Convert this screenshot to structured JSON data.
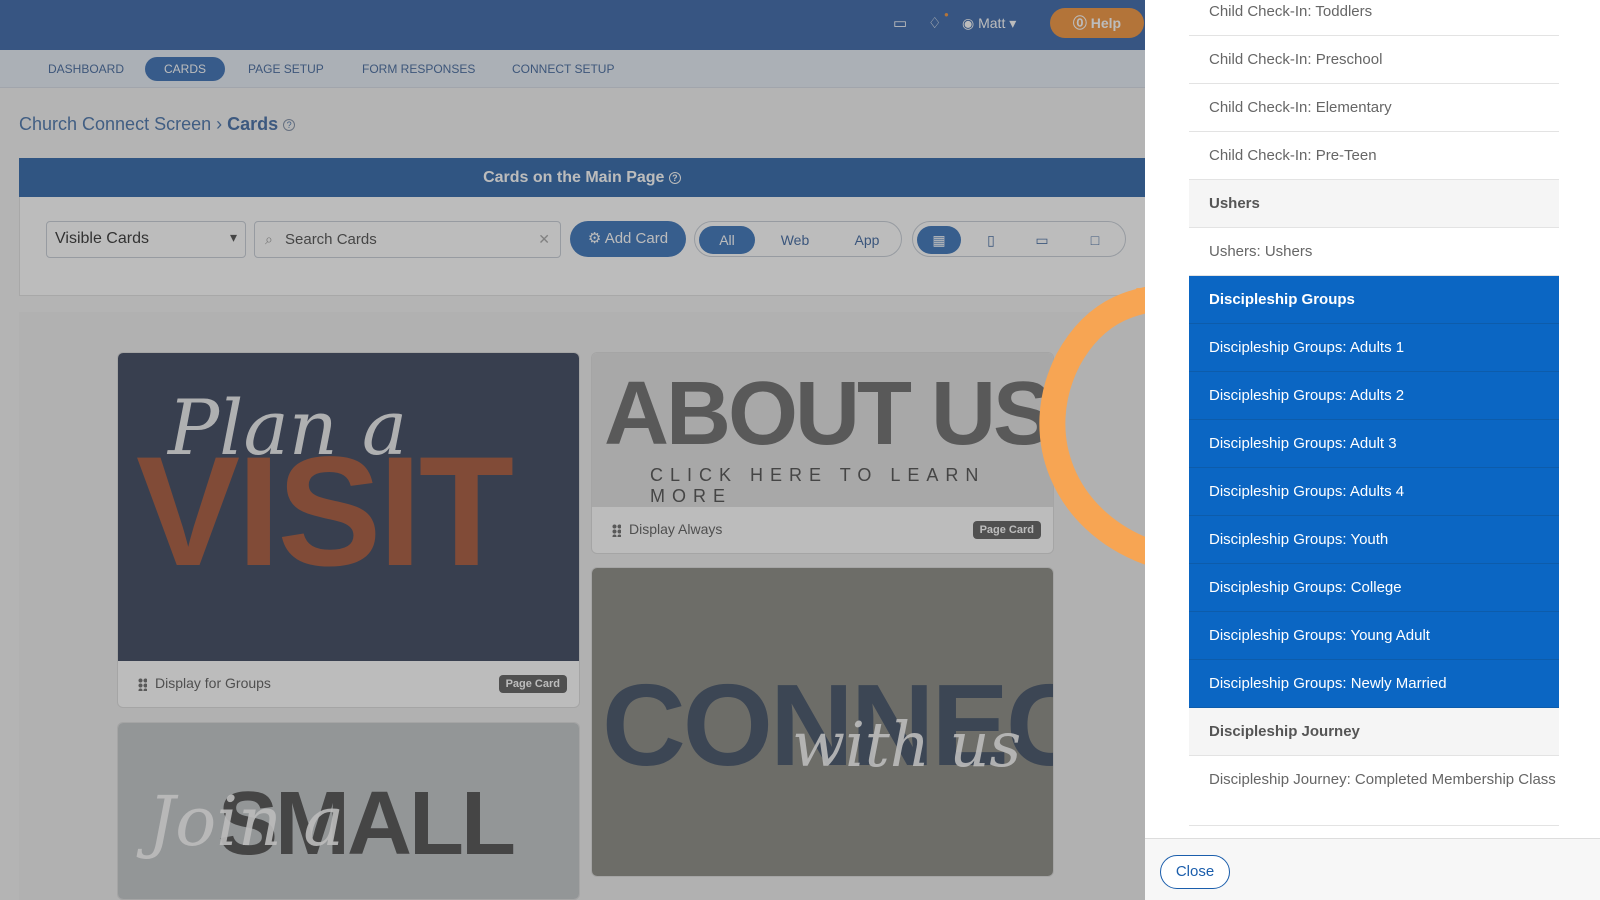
{
  "topbar": {
    "user_name": "Matt",
    "help_label": "Help",
    "calendar_icon": "calendar-icon",
    "bell_icon": "bell-icon",
    "user_icon": "user-icon"
  },
  "nav": {
    "tabs": [
      "DASHBOARD",
      "CARDS",
      "PAGE SETUP",
      "FORM RESPONSES",
      "CONNECT SETUP"
    ]
  },
  "breadcrumb": {
    "parent": "Church Connect Screen",
    "current": "Cards"
  },
  "section": {
    "title": "Cards on the Main Page"
  },
  "toolbar": {
    "visibility_value": "Visible Cards",
    "search_placeholder": "Search Cards",
    "add_label": "Add Card",
    "filter_all": "All",
    "filter_web": "Web",
    "filter_app": "App"
  },
  "cards": [
    {
      "art_script": "Plan a",
      "art_word": "VISIT",
      "caption": "Display for Groups",
      "badge": "Page Card"
    },
    {
      "art_word": "ABOUT US",
      "art_subtitle": "CLICK HERE TO LEARN MORE",
      "caption": "Display Always",
      "badge": "Page Card"
    },
    {
      "art_word": "CONNECT",
      "art_script": "with us"
    },
    {
      "art_script": "Join a",
      "art_word": "SMALL"
    }
  ],
  "panel": {
    "items": [
      "Child Check-In: Toddlers",
      "Child Check-In: Preschool",
      "Child Check-In: Elementary",
      "Child Check-In: Pre-Teen",
      "Ushers",
      "Ushers: Ushers",
      "Discipleship Groups",
      "Discipleship Groups: Adults 1",
      "Discipleship Groups: Adults 2",
      "Discipleship Groups: Adult 3",
      "Discipleship Groups: Adults 4",
      "Discipleship Groups: Youth",
      "Discipleship Groups: College",
      "Discipleship Groups: Young Adult",
      "Discipleship Groups: Newly Married",
      "Discipleship Journey",
      "Discipleship Journey: Completed Membership Class"
    ],
    "close_label": "Close"
  },
  "colors": {
    "accent": "#0b66c3",
    "nav": "#1a4f9c",
    "help": "#f0841e",
    "arrow": "#f7a553"
  }
}
